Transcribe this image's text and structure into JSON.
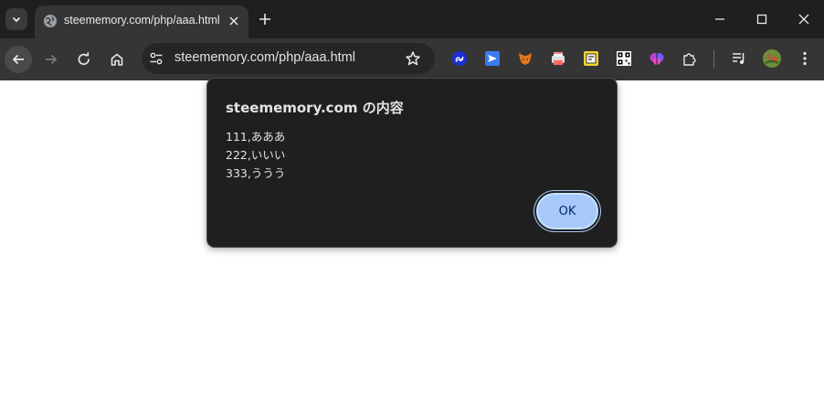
{
  "tab": {
    "title": "steememory.com/php/aaa.html"
  },
  "omnibox": {
    "url": "steememory.com/php/aaa.html"
  },
  "dialog": {
    "heading": "steememory.com の内容",
    "lines": [
      "111,あああ",
      "222,いいい",
      "333,ううう"
    ],
    "ok_label": "OK"
  },
  "icons": {
    "tab_search": "chevron-down-icon",
    "favicon": "globe-icon",
    "tab_close": "close-icon",
    "new_tab": "plus-icon",
    "minimize": "minimize-icon",
    "maximize": "maximize-icon",
    "close_window": "close-icon",
    "back": "arrow-left-icon",
    "forward": "arrow-right-icon",
    "reload": "reload-icon",
    "home": "home-icon",
    "site_info": "tune-icon",
    "bookmark": "star-icon",
    "extensions": [
      "steem-extension-icon",
      "send-extension-icon",
      "metamask-fox-icon",
      "printer-extension-icon",
      "note-extension-icon",
      "qr-code-icon",
      "brain-extension-icon",
      "puzzle-icon"
    ],
    "media": "media-queue-icon",
    "profile": "avatar"
  },
  "colors": {
    "tabstrip": "#1f1f1f",
    "toolbar": "#353535",
    "dialog_bg": "#1f1f1f",
    "ok_button": "#a8c7fa",
    "ok_text": "#062e6f"
  }
}
